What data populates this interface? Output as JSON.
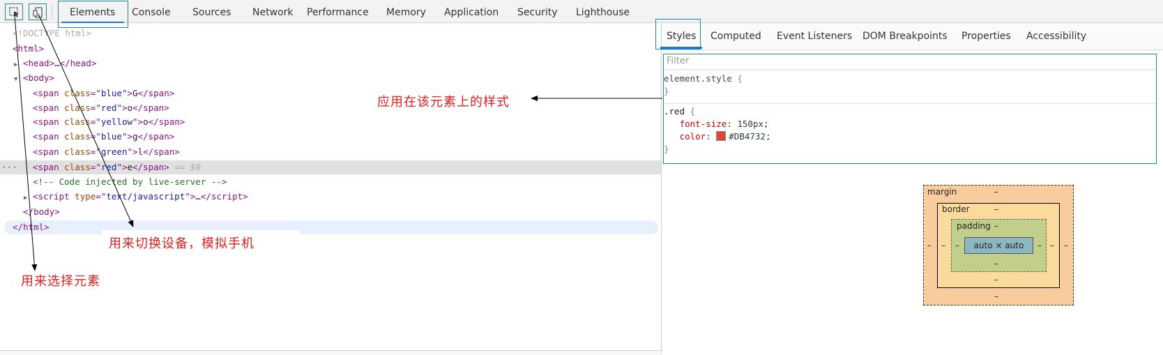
{
  "toolbar": {
    "tabs": [
      "Elements",
      "Console",
      "Sources",
      "Network",
      "Performance",
      "Memory",
      "Application",
      "Security",
      "Lighthouse"
    ]
  },
  "dom": {
    "doctype": "<!DOCTYPE html>",
    "html_open": "html",
    "head": "head",
    "head_ellipsis": "…",
    "body": "body",
    "spans": [
      {
        "class": "blue",
        "text": "G"
      },
      {
        "class": "red",
        "text": "o"
      },
      {
        "class": "yellow",
        "text": "o"
      },
      {
        "class": "blue",
        "text": "g"
      },
      {
        "class": "green",
        "text": "l"
      },
      {
        "class": "red",
        "text": "e"
      }
    ],
    "selected_marker": "== $0",
    "row_dots": "···",
    "comment": "<!-- Code injected by live-server -->",
    "script_type": "text/javascript",
    "script_ellipsis": "…",
    "body_close": "body",
    "html_close": "html"
  },
  "side_tabs": [
    "Styles",
    "Computed",
    "Event Listeners",
    "DOM Breakpoints",
    "Properties",
    "Accessibility"
  ],
  "styles": {
    "filter_placeholder": "Filter",
    "element_style_selector": "element.style",
    "rule_selector": ".red",
    "properties": [
      {
        "name": "font-size",
        "value": "150px"
      },
      {
        "name": "color",
        "value": "#DB4732"
      }
    ],
    "swatch_color": "#DB4732"
  },
  "box_model": {
    "margin_label": "margin",
    "border_label": "border",
    "padding_label": "padding",
    "content": "auto × auto",
    "dash": "–"
  },
  "annotations": {
    "styles_note": "应用在该元素上的样式",
    "device_note": "用来切换设备，模拟手机",
    "select_note": "用来选择元素"
  },
  "colors": {
    "highlight_box": "#1a8a8e",
    "annotation": "#e02020",
    "tab_underline": "#1a73e8"
  }
}
